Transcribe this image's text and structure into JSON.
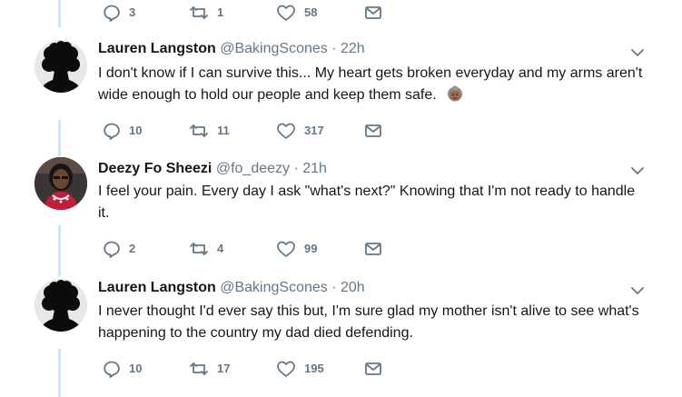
{
  "top_actions": {
    "reply_count": "3",
    "retweet_count": "1",
    "like_count": "58"
  },
  "tweets": [
    {
      "name": "Lauren Langston",
      "handle": "@BakingScones",
      "dot": "·",
      "time": "22h",
      "text": "I don't know if I can survive this... My heart gets broken everyday and my arms aren't wide enough to hold our people and keep them safe.",
      "emoji_icon": "old-woman-emoji-icon",
      "reply_count": "10",
      "retweet_count": "11",
      "like_count": "317"
    },
    {
      "name": "Deezy Fo Sheezi",
      "handle": "@fo_deezy",
      "dot": "·",
      "time": "21h",
      "text": "I feel your pain. Every day I ask \"what's next?\" Knowing that I'm not ready to handle it.",
      "reply_count": "2",
      "retweet_count": "4",
      "like_count": "99"
    },
    {
      "name": "Lauren Langston",
      "handle": "@BakingScones",
      "dot": "·",
      "time": "20h",
      "text": "I never thought I'd ever say this but, I'm sure glad my mother isn't alive to see what's happening to the country my dad died defending.",
      "reply_count": "10",
      "retweet_count": "17",
      "like_count": "195"
    }
  ],
  "colors": {
    "icon_gray": "#657786",
    "thread_line": "#cfe6f5",
    "text": "#14171a"
  }
}
